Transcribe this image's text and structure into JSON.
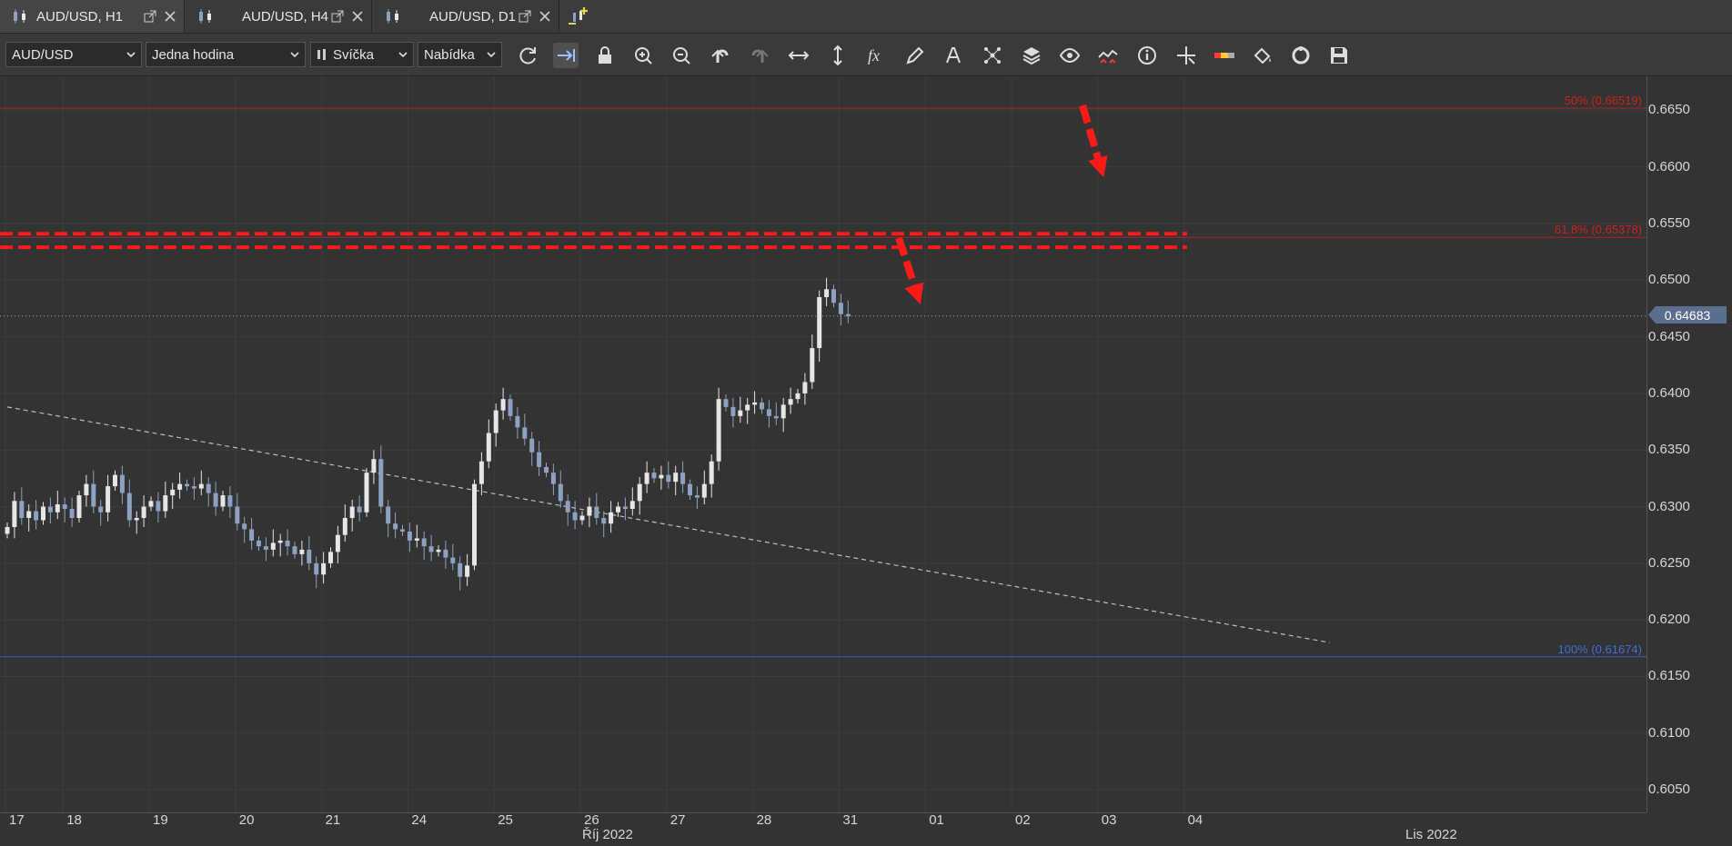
{
  "tabs": [
    {
      "label": "AUD/USD, H1",
      "active": true
    },
    {
      "label": "AUD/USD, H4",
      "active": false
    },
    {
      "label": "AUD/USD, D1",
      "active": false
    }
  ],
  "toolbar": {
    "instrument": "AUD/USD",
    "period": "Jedna hodina",
    "chart_type": "Svíčka",
    "price_side": "Nabídka",
    "icons": [
      "refresh-icon",
      "shift-icon",
      "lock-icon",
      "zoom-in-icon",
      "zoom-out-icon",
      "undo-icon",
      "redo-icon",
      "horizontal-arrows-icon",
      "vertical-arrows-icon",
      "fx-icon",
      "pencil-icon",
      "text-icon",
      "pattern-icon",
      "layers-icon",
      "eye-icon",
      "signals-icon",
      "info-icon",
      "crosshair-icon",
      "indicator-bar-icon",
      "paint-bucket-icon",
      "cycle-icon",
      "save-icon"
    ]
  },
  "y_axis": {
    "labels": [
      "0.6650",
      "0.6600",
      "0.6550",
      "0.6500",
      "0.6450",
      "0.6400",
      "0.6350",
      "0.6300",
      "0.6250",
      "0.6200",
      "0.6150",
      "0.6100",
      "0.6050"
    ],
    "current_price": "0.64683"
  },
  "x_axis": {
    "days": [
      "17",
      "18",
      "19",
      "20",
      "21",
      "24",
      "25",
      "26",
      "27",
      "28",
      "31",
      "01",
      "02",
      "03",
      "04"
    ],
    "months": [
      "Říj 2022",
      "Lis 2022"
    ]
  },
  "fibonacci": [
    {
      "label": "50% (0.66519)",
      "price": 0.66519,
      "color": "#d02020"
    },
    {
      "label": "61.8% (0.65378)",
      "price": 0.65378,
      "color": "#d02020"
    },
    {
      "label": "100% (0.61674)",
      "price": 0.61674,
      "color": "#3f6fd6"
    }
  ],
  "colors": {
    "background": "#333333",
    "candle": "#8da1c0",
    "annotation": "#ff1a1a"
  },
  "chart_data": {
    "type": "candlestick",
    "instrument": "AUD/USD",
    "timeframe": "H1",
    "ylim": [
      0.603,
      0.668
    ],
    "trendline": {
      "from": [
        0,
        0.6388
      ],
      "to": [
        184,
        0.618
      ]
    },
    "resistance_zone": [
      0.6529,
      0.6541
    ],
    "x_day_index": [
      {
        "label": "17",
        "i": 0
      },
      {
        "label": "18",
        "i": 8
      },
      {
        "label": "19",
        "i": 20
      },
      {
        "label": "20",
        "i": 32
      },
      {
        "label": "21",
        "i": 44
      },
      {
        "label": "24",
        "i": 56
      },
      {
        "label": "25",
        "i": 68
      },
      {
        "label": "26",
        "i": 80
      },
      {
        "label": "27",
        "i": 92
      },
      {
        "label": "28",
        "i": 104
      },
      {
        "label": "31",
        "i": 116
      },
      {
        "label": "01",
        "i": 128
      },
      {
        "label": "02",
        "i": 140
      },
      {
        "label": "03",
        "i": 152
      },
      {
        "label": "04",
        "i": 164
      }
    ],
    "closes": [
      0.6282,
      0.6305,
      0.629,
      0.6296,
      0.6288,
      0.63,
      0.6295,
      0.6302,
      0.6298,
      0.629,
      0.631,
      0.632,
      0.63,
      0.6295,
      0.6318,
      0.6328,
      0.6312,
      0.6288,
      0.629,
      0.63,
      0.6305,
      0.6296,
      0.631,
      0.6315,
      0.632,
      0.6318,
      0.6316,
      0.632,
      0.6312,
      0.63,
      0.631,
      0.63,
      0.6285,
      0.628,
      0.627,
      0.6265,
      0.6262,
      0.6268,
      0.627,
      0.6265,
      0.6258,
      0.6262,
      0.625,
      0.624,
      0.625,
      0.626,
      0.6275,
      0.629,
      0.63,
      0.6295,
      0.633,
      0.6342,
      0.63,
      0.6285,
      0.628,
      0.6278,
      0.627,
      0.6272,
      0.6265,
      0.626,
      0.6262,
      0.6255,
      0.625,
      0.6238,
      0.6248,
      0.632,
      0.634,
      0.6365,
      0.6385,
      0.6395,
      0.638,
      0.637,
      0.636,
      0.6348,
      0.6335,
      0.633,
      0.632,
      0.6305,
      0.6295,
      0.6288,
      0.6292,
      0.63,
      0.629,
      0.6285,
      0.6295,
      0.63,
      0.6298,
      0.6305,
      0.632,
      0.633,
      0.6325,
      0.6328,
      0.6322,
      0.633,
      0.632,
      0.631,
      0.6308,
      0.632,
      0.634,
      0.6395,
      0.6388,
      0.638,
      0.6385,
      0.639,
      0.6392,
      0.6386,
      0.638,
      0.6378,
      0.639,
      0.6395,
      0.64,
      0.641,
      0.644,
      0.6485,
      0.6492,
      0.648,
      0.647,
      0.6468
    ]
  }
}
